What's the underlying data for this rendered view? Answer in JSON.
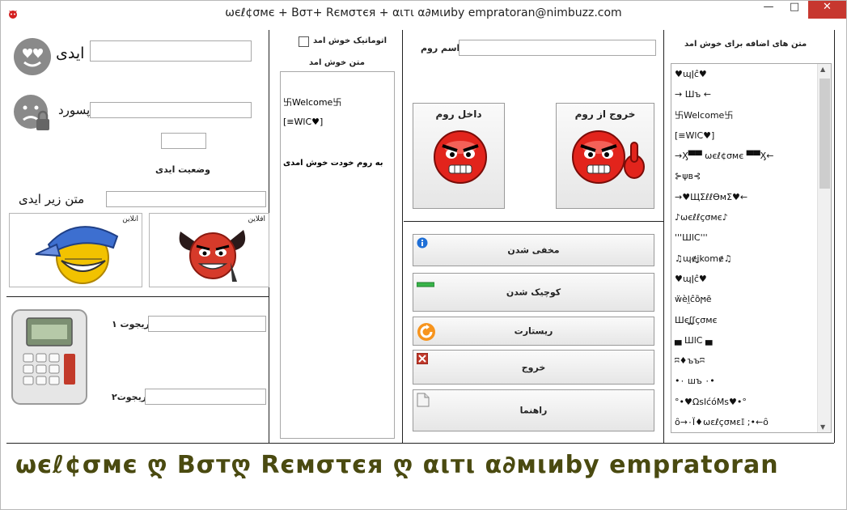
{
  "window": {
    "title": "ωєℓ¢σмє + Bσт+  Rємστєя + αιтι α∂мιиby empratoran@nimbuzz.com",
    "min_label": "—",
    "max_label": "□",
    "close_label": "✕"
  },
  "login": {
    "id_label": "ایدی",
    "password_label": "پسورد",
    "id_value": "",
    "password_value": "",
    "status_value": "",
    "status_label": "وضعیت ایدی",
    "under_id_label": "متن زیر ایدی",
    "under_id_value": "",
    "online_label": "انلاین",
    "offline_label": "افلاین"
  },
  "refs": {
    "ref1_label": "ریجوت ۱",
    "ref2_label": "ریجوت۲",
    "ref1_value": "",
    "ref2_value": ""
  },
  "welcome": {
    "auto_label": "اتوماتیک خوش امد",
    "text_label": "متن خوش امد",
    "lines": [
      "卐Welcome卐",
      "[≡WlC♥]",
      "",
      "به روم خودت خوش امدی"
    ]
  },
  "room": {
    "name_label": "اسم روم",
    "name_value": "",
    "enter_label": "داخل روم",
    "exit_label": "خروج از روم"
  },
  "actions": {
    "hide": "مخفی شدن",
    "minimize": "کوچیک شدن",
    "restart": "ریستارت",
    "exit": "خروج",
    "help": "راهنما"
  },
  "extra_texts": {
    "label": "متن های اضافه برای خوش امد",
    "items": [
      "♥ɰǀĉ♥",
      "→ Шъ ←",
      "卐Welcome卐",
      "[≡WlC♥]",
      "→Ӽ▀▀ ωєℓ¢σмє ▀▀Ӽ←",
      "⊱ψв⊰",
      "→♥ЩΣℓℓϴмΣ♥←",
      "♪ωєℓℓçσмє♪",
      "'''ШlC'''",
      "♫ɰɇʝkomɇ♫",
      "♥ɰǀĉ♥",
      "ẅèl̤ĉȍϻē",
      "Шєʆʆçσмє",
      "▄ ШlC ▄",
      "ʭ♦ъъʭ",
      "•٠ шъ ٠•",
      "°•♥ΩslćóMs♥•°",
      "ȏ→٠Ϊ♦ωεℓçσмε𝕀 ;•←ȏ"
    ]
  },
  "footer": {
    "text": "ωєℓ¢σмє ღ Bσтღ  Rємστєя ღ αιтι α∂мιиby empratoran"
  },
  "colors": {
    "close_button": "#c7372f",
    "footer_text": "#4a4a10",
    "window_border": "#b9b9b9"
  }
}
